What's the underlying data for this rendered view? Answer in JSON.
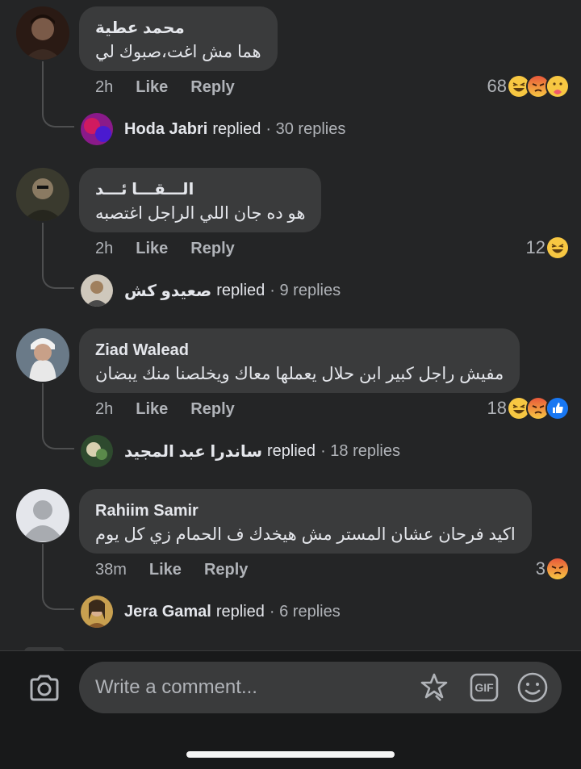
{
  "comments": [
    {
      "author": "محمد عطية",
      "text": "هما مش اغت،صبوك لي",
      "time": "2h",
      "like_label": "Like",
      "reply_label": "Reply",
      "reaction_count": "68",
      "reactions": [
        "haha",
        "angry",
        "care"
      ],
      "reply_preview": {
        "author": "Hoda Jabri",
        "word": "replied",
        "count": "· 30 replies"
      }
    },
    {
      "author": "الـــقـــا ئـــد",
      "text": "هو ده جان اللي الراجل اغتصبه",
      "time": "2h",
      "like_label": "Like",
      "reply_label": "Reply",
      "reaction_count": "12",
      "reactions": [
        "haha"
      ],
      "reply_preview": {
        "author": "صعيدو كش",
        "word": "replied",
        "count": "· 9 replies"
      }
    },
    {
      "author": "Ziad Walead",
      "text": "مفيش راجل كبير ابن حلال يعملها معاك ويخلصنا منك يبضان",
      "time": "2h",
      "like_label": "Like",
      "reply_label": "Reply",
      "reaction_count": "18",
      "reactions": [
        "haha",
        "angry",
        "like"
      ],
      "reply_preview": {
        "author": "ساندرا عبد المجيد",
        "word": "replied",
        "count": "· 18 replies"
      }
    },
    {
      "author": "Rahiim Samir",
      "text": "اكيد فرحان عشان المستر مش هيخدك ف الحمام زي كل يوم",
      "time": "38m",
      "like_label": "Like",
      "reply_label": "Reply",
      "reaction_count": "3",
      "reactions": [
        "angry"
      ],
      "reply_preview": {
        "author": "Jera Gamal",
        "word": "replied",
        "count": "· 6 replies"
      }
    }
  ],
  "composer": {
    "placeholder": "Write a comment...",
    "gif_label": "GIF"
  },
  "colors": {
    "background": "#242526",
    "bubble": "#3a3b3c",
    "muted": "#b0b3b8",
    "like_blue": "#1877f2"
  },
  "icons": [
    "camera-icon",
    "sticker-icon",
    "gif-icon",
    "emoji-icon"
  ]
}
